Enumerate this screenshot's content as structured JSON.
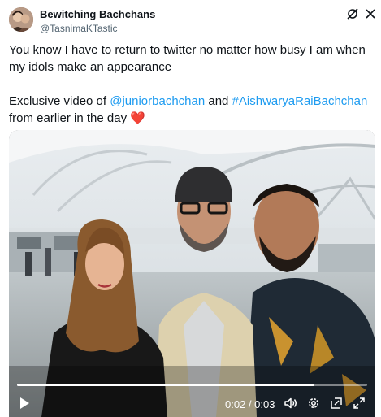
{
  "author": {
    "display_name": "Bewitching Bachchans",
    "handle": "@TasnimaKTastic",
    "avatar_icon": "avatar-photo"
  },
  "header_actions": {
    "grok_icon": "grok-icon",
    "close_icon": "close-icon"
  },
  "tweet": {
    "line1": "You know I have to return to twitter no matter how busy I am when my idols make an appearance",
    "line2_prefix": "Exclusive video of ",
    "mention1": "@juniorbachchan",
    "line2_mid": " and ",
    "mention2": "#AishwaryaRaiBachchan",
    "line2_suffix": " from earlier in the day ",
    "heart": "❤️"
  },
  "video": {
    "current_time": "0:02",
    "separator": " / ",
    "duration": "0:03",
    "progress": 0.85,
    "icons": [
      "play-icon",
      "volume-icon",
      "settings-icon",
      "pip-icon",
      "fullscreen-icon"
    ]
  },
  "colors": {
    "link": "#1d9bf0",
    "heart": "#e0245e",
    "text": "#0f1419",
    "muted": "#536471"
  }
}
